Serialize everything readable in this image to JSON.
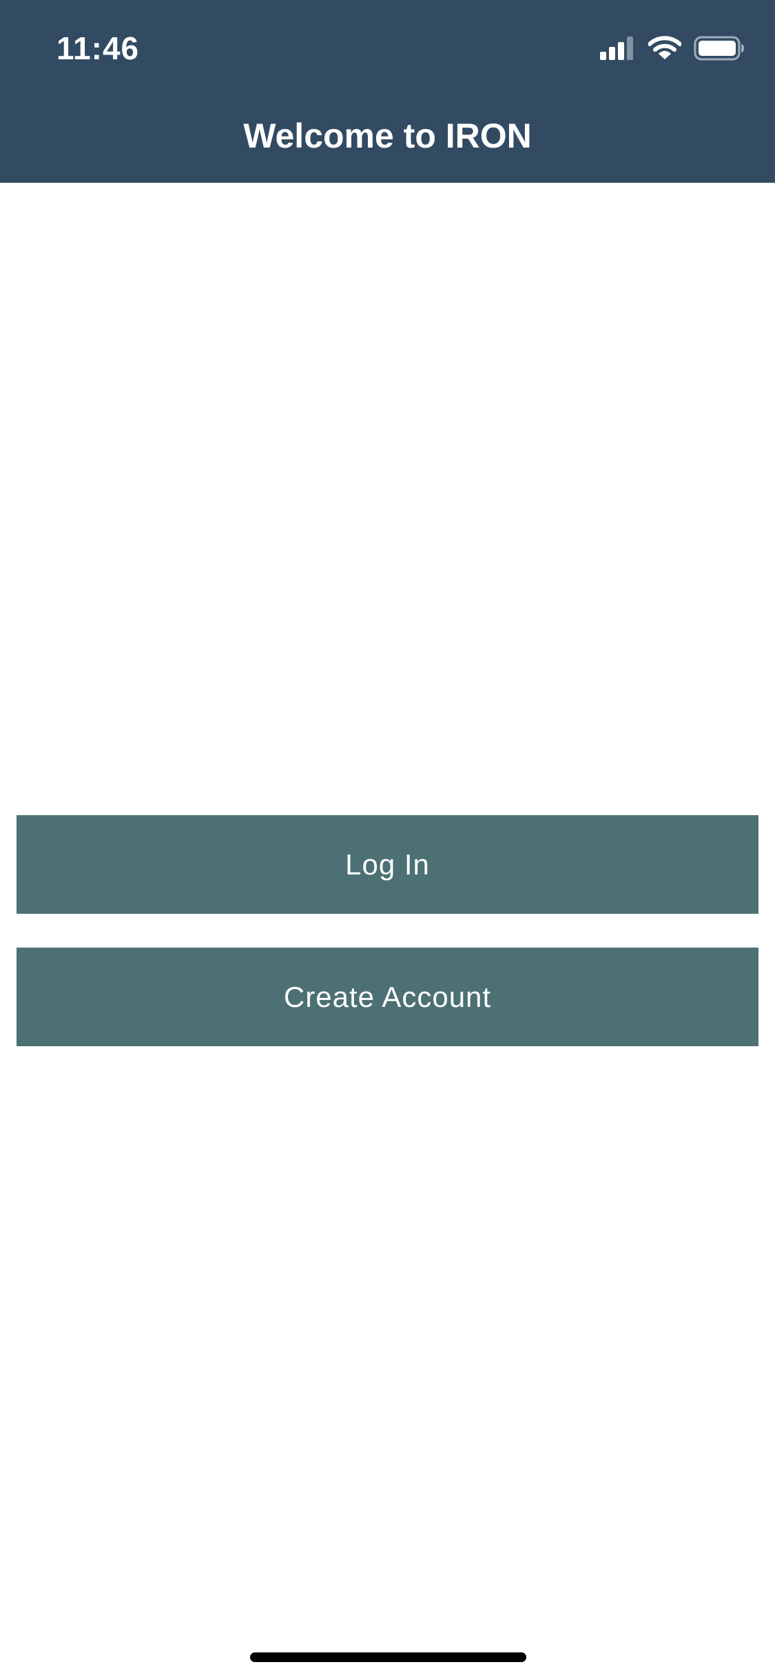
{
  "status_bar": {
    "time": "11:46",
    "icons": [
      "cellular-signal-icon",
      "wifi-icon",
      "battery-icon"
    ]
  },
  "header": {
    "title": "Welcome to IRON"
  },
  "actions": {
    "login_label": "Log In",
    "create_account_label": "Create Account"
  },
  "colors": {
    "header_background": "#324b63",
    "button_background": "#4c7073",
    "button_text": "#ffffff",
    "page_background": "#ffffff"
  }
}
